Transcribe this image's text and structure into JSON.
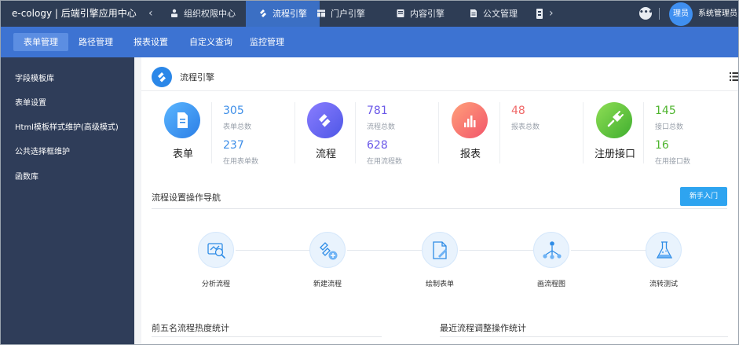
{
  "app": {
    "title": "e-cology | 后端引擎应用中心"
  },
  "topnav": {
    "prev_arrow": "‹",
    "next_arrow": "›",
    "tabs": [
      {
        "label": "组织权限中心",
        "icon": "org-icon"
      },
      {
        "label": "流程引擎",
        "icon": "workflow-icon",
        "active": true
      },
      {
        "label": "门户引擎",
        "icon": "portal-icon"
      },
      {
        "label": "内容引擎",
        "icon": "content-icon"
      },
      {
        "label": "公文管理",
        "icon": "document-icon"
      }
    ],
    "chat_icon": "chat-icon",
    "avatar_text": "理员",
    "username": "系统管理员"
  },
  "subnav": {
    "tabs": [
      {
        "label": "表单管理",
        "active": true
      },
      {
        "label": "路径管理"
      },
      {
        "label": "报表设置"
      },
      {
        "label": "自定义查询"
      },
      {
        "label": "监控管理"
      }
    ]
  },
  "sidebar": {
    "items": [
      {
        "label": "字段模板库"
      },
      {
        "label": "表单设置"
      },
      {
        "label": "Html模板样式维护(高级模式)"
      },
      {
        "label": "公共选择框维护"
      },
      {
        "label": "函数库"
      }
    ]
  },
  "main": {
    "header_title": "流程引擎",
    "stats": [
      {
        "name": "表单",
        "icon": "form-doc-icon",
        "color": "#2b87e8",
        "metrics": [
          {
            "value": "305",
            "label": "表单总数"
          },
          {
            "value": "237",
            "label": "在用表单数"
          }
        ],
        "accent": "#3f8fe8"
      },
      {
        "name": "流程",
        "icon": "workflow-icon",
        "color": "#6c5cf0",
        "metrics": [
          {
            "value": "781",
            "label": "流程总数"
          },
          {
            "value": "628",
            "label": "在用流程数"
          }
        ],
        "accent": "#6a58e8"
      },
      {
        "name": "报表",
        "icon": "bar-chart-icon",
        "color": "#f46a6a",
        "metrics": [
          {
            "value": "48",
            "label": "报表总数"
          }
        ],
        "accent": "#f06a6a"
      },
      {
        "name": "注册接口",
        "icon": "plug-icon",
        "color": "#55c13a",
        "metrics": [
          {
            "value": "145",
            "label": "接口总数"
          },
          {
            "value": "16",
            "label": "在用接口数"
          }
        ],
        "accent": "#4fb52f"
      }
    ],
    "guide": {
      "title": "流程设置操作导航",
      "button_label": "新手入门",
      "steps": [
        {
          "label": "分析流程",
          "icon": "analyze-icon"
        },
        {
          "label": "新建流程",
          "icon": "new-workflow-icon"
        },
        {
          "label": "绘制表单",
          "icon": "draw-form-icon"
        },
        {
          "label": "画流程图",
          "icon": "flowchart-icon"
        },
        {
          "label": "流转测试",
          "icon": "flask-icon"
        }
      ]
    },
    "bottom_left_title": "前五名流程热度统计",
    "bottom_right_title": "最近流程调整操作统计"
  }
}
